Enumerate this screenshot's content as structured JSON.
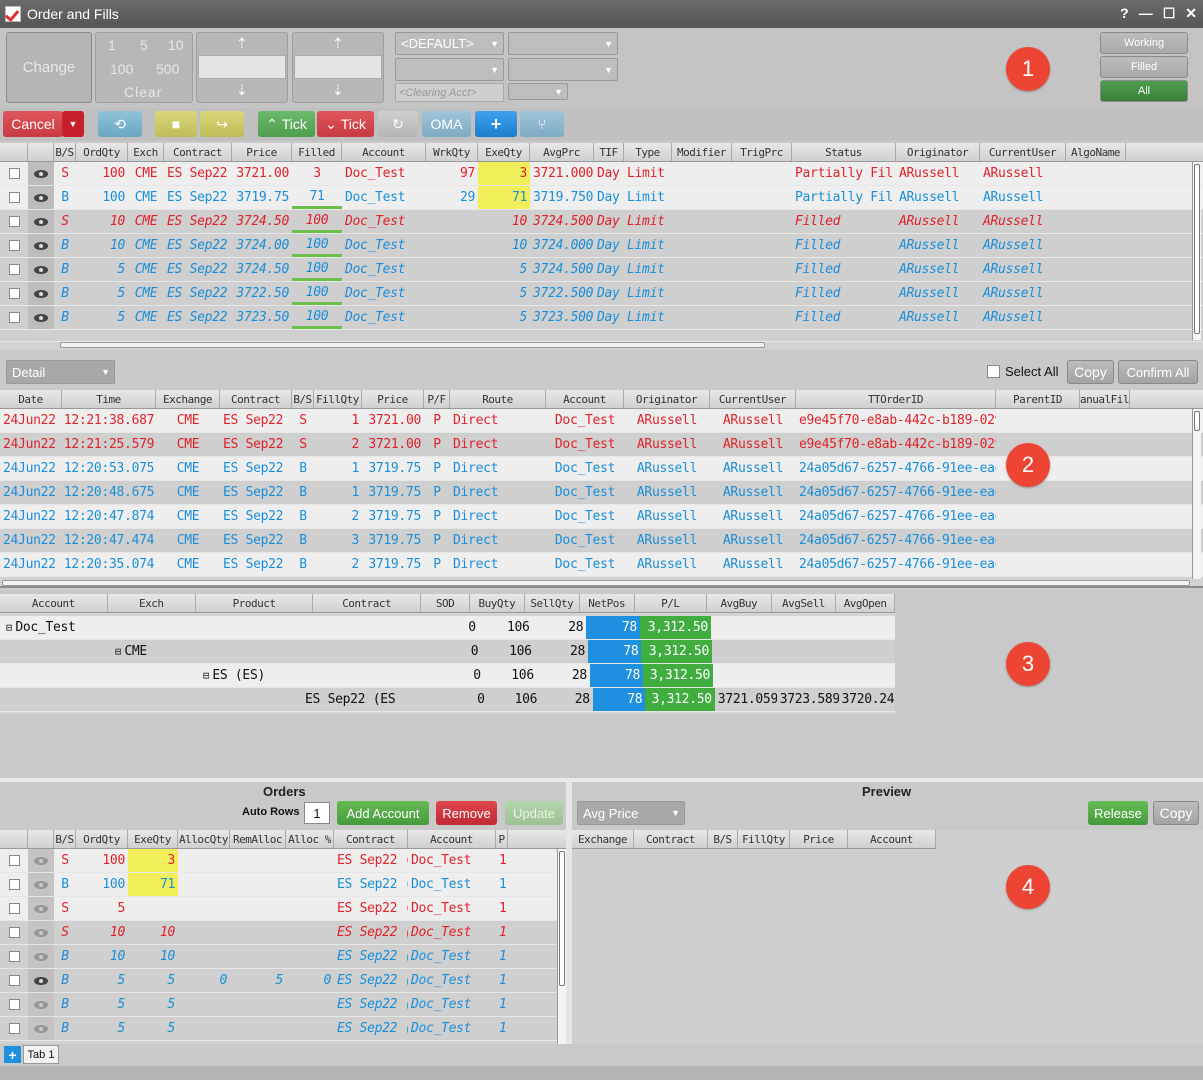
{
  "window": {
    "title": "Order and Fills",
    "controls": [
      "?",
      "—",
      "☐",
      "✕"
    ]
  },
  "toolbar": {
    "change": "Change",
    "qty": [
      "1",
      "5",
      "10",
      "100",
      "500",
      "Clear"
    ],
    "default_acct": "<DEFAULT>",
    "clearing_acct": "<Clearing Acct>",
    "status_buttons": [
      "Working",
      "Filled",
      "All"
    ]
  },
  "actions": {
    "cancel": "Cancel",
    "tick_up": "Tick",
    "tick_down": "Tick",
    "oma": "OMA",
    "plus": "+"
  },
  "orders": {
    "columns": [
      "",
      "",
      "B/S",
      "OrdQty",
      "Exch",
      "Contract",
      "Price",
      "Filled",
      "Account",
      "WrkQty",
      "ExeQty",
      "AvgPrc",
      "TIF",
      "Type",
      "Modifier",
      "TrigPrc",
      "Status",
      "Originator",
      "CurrentUser",
      "AlgoName"
    ],
    "rows": [
      {
        "bs": "S",
        "qty": "100",
        "exch": "CME",
        "contract": "ES Sep22 (",
        "price": "3721.00",
        "filled": "3",
        "account": "Doc_Test",
        "wrk": "97",
        "exe": "3",
        "avg": "3721.000",
        "tif": "Day",
        "type": "Limit",
        "status": "Partially Fil",
        "orig": "ARussell",
        "user": "ARussell"
      },
      {
        "bs": "B",
        "qty": "100",
        "exch": "CME",
        "contract": "ES Sep22 (",
        "price": "3719.75",
        "filled": "71",
        "account": "Doc_Test",
        "wrk": "29",
        "exe": "71",
        "avg": "3719.750",
        "tif": "Day",
        "type": "Limit",
        "status": "Partially Fil",
        "orig": "ARussell",
        "user": "ARussell"
      },
      {
        "bs": "S",
        "qty": "10",
        "exch": "CME",
        "contract": "ES Sep22 (",
        "price": "3724.50",
        "filled": "100",
        "account": "Doc_Test",
        "wrk": "",
        "exe": "10",
        "avg": "3724.500",
        "tif": "Day",
        "type": "Limit",
        "status": "Filled",
        "orig": "ARussell",
        "user": "ARussell"
      },
      {
        "bs": "B",
        "qty": "10",
        "exch": "CME",
        "contract": "ES Sep22 (",
        "price": "3724.00",
        "filled": "100",
        "account": "Doc_Test",
        "wrk": "",
        "exe": "10",
        "avg": "3724.000",
        "tif": "Day",
        "type": "Limit",
        "status": "Filled",
        "orig": "ARussell",
        "user": "ARussell"
      },
      {
        "bs": "B",
        "qty": "5",
        "exch": "CME",
        "contract": "ES Sep22 (",
        "price": "3724.50",
        "filled": "100",
        "account": "Doc_Test",
        "wrk": "",
        "exe": "5",
        "avg": "3724.500",
        "tif": "Day",
        "type": "Limit",
        "status": "Filled",
        "orig": "ARussell",
        "user": "ARussell"
      },
      {
        "bs": "B",
        "qty": "5",
        "exch": "CME",
        "contract": "ES Sep22 (",
        "price": "3722.50",
        "filled": "100",
        "account": "Doc_Test",
        "wrk": "",
        "exe": "5",
        "avg": "3722.500",
        "tif": "Day",
        "type": "Limit",
        "status": "Filled",
        "orig": "ARussell",
        "user": "ARussell"
      },
      {
        "bs": "B",
        "qty": "5",
        "exch": "CME",
        "contract": "ES Sep22 (",
        "price": "3723.50",
        "filled": "100",
        "account": "Doc_Test",
        "wrk": "",
        "exe": "5",
        "avg": "3723.500",
        "tif": "Day",
        "type": "Limit",
        "status": "Filled",
        "orig": "ARussell",
        "user": "ARussell"
      }
    ]
  },
  "fills": {
    "view": "Detail",
    "select_all": "Select All",
    "copy": "Copy",
    "confirm_all": "Confirm All",
    "columns": [
      "Date",
      "Time",
      "Exchange",
      "Contract",
      "B/S",
      "FillQty",
      "Price",
      "P/F",
      "Route",
      "Account",
      "Originator",
      "CurrentUser",
      "TTOrderID",
      "ParentID",
      "ManualFill"
    ],
    "rows": [
      {
        "date": "24Jun22",
        "time": "12:21:38.687",
        "exch": "CME",
        "contract": "ES Sep22 (",
        "bs": "S",
        "qty": "1",
        "price": "3721.00",
        "pf": "P",
        "route": "Direct",
        "account": "Doc_Test",
        "orig": "ARussell",
        "user": "ARussell",
        "id": "e9e45f70-e8ab-442c-b189-0297d4f"
      },
      {
        "date": "24Jun22",
        "time": "12:21:25.579",
        "exch": "CME",
        "contract": "ES Sep22 (",
        "bs": "S",
        "qty": "2",
        "price": "3721.00",
        "pf": "P",
        "route": "Direct",
        "account": "Doc_Test",
        "orig": "ARussell",
        "user": "ARussell",
        "id": "e9e45f70-e8ab-442c-b189-0297d4f"
      },
      {
        "date": "24Jun22",
        "time": "12:20:53.075",
        "exch": "CME",
        "contract": "ES Sep22 (",
        "bs": "B",
        "qty": "1",
        "price": "3719.75",
        "pf": "P",
        "route": "Direct",
        "account": "Doc_Test",
        "orig": "ARussell",
        "user": "ARussell",
        "id": "24a05d67-6257-4766-91ee-eadbad0"
      },
      {
        "date": "24Jun22",
        "time": "12:20:48.675",
        "exch": "CME",
        "contract": "ES Sep22 (",
        "bs": "B",
        "qty": "1",
        "price": "3719.75",
        "pf": "P",
        "route": "Direct",
        "account": "Doc_Test",
        "orig": "ARussell",
        "user": "ARussell",
        "id": "24a05d67-6257-4766-91ee-eadbad0"
      },
      {
        "date": "24Jun22",
        "time": "12:20:47.874",
        "exch": "CME",
        "contract": "ES Sep22 (",
        "bs": "B",
        "qty": "2",
        "price": "3719.75",
        "pf": "P",
        "route": "Direct",
        "account": "Doc_Test",
        "orig": "ARussell",
        "user": "ARussell",
        "id": "24a05d67-6257-4766-91ee-eadbad0"
      },
      {
        "date": "24Jun22",
        "time": "12:20:47.474",
        "exch": "CME",
        "contract": "ES Sep22 (",
        "bs": "B",
        "qty": "3",
        "price": "3719.75",
        "pf": "P",
        "route": "Direct",
        "account": "Doc_Test",
        "orig": "ARussell",
        "user": "ARussell",
        "id": "24a05d67-6257-4766-91ee-eadbad0"
      },
      {
        "date": "24Jun22",
        "time": "12:20:35.074",
        "exch": "CME",
        "contract": "ES Sep22 (",
        "bs": "B",
        "qty": "2",
        "price": "3719.75",
        "pf": "P",
        "route": "Direct",
        "account": "Doc_Test",
        "orig": "ARussell",
        "user": "ARussell",
        "id": "24a05d67-6257-4766-91ee-eadbad0"
      }
    ]
  },
  "positions": {
    "columns": [
      "Account",
      "Exch",
      "Product",
      "Contract",
      "SOD",
      "BuyQty",
      "SellQty",
      "NetPos",
      "P/L",
      "AvgBuy",
      "AvgSell",
      "AvgOpen"
    ],
    "rows": [
      {
        "label": "Doc_Test",
        "sod": "0",
        "buy": "106",
        "sell": "28",
        "net": "78",
        "pl": "3,312.50",
        "avgbuy": "",
        "avgsell": "",
        "avgopen": ""
      },
      {
        "label": "CME",
        "sod": "0",
        "buy": "106",
        "sell": "28",
        "net": "78",
        "pl": "3,312.50",
        "avgbuy": "",
        "avgsell": "",
        "avgopen": ""
      },
      {
        "label": "ES (ES)",
        "sod": "0",
        "buy": "106",
        "sell": "28",
        "net": "78",
        "pl": "3,312.50",
        "avgbuy": "",
        "avgsell": "",
        "avgopen": ""
      },
      {
        "label": "ES Sep22 (ES",
        "sod": "0",
        "buy": "106",
        "sell": "28",
        "net": "78",
        "pl": "3,312.50",
        "avgbuy": "3721.059",
        "avgsell": "3723.589",
        "avgopen": "3720.244"
      }
    ]
  },
  "alloc": {
    "title": "Orders",
    "auto_rows_label": "Auto Rows",
    "auto_rows": "1",
    "add_account": "Add Account",
    "remove": "Remove",
    "update": "Update",
    "columns": [
      "",
      "",
      "B/S",
      "OrdQty",
      "ExeQty",
      "AllocQty",
      "RemAlloc",
      "Alloc %",
      "Contract",
      "Account",
      "P"
    ],
    "rows": [
      {
        "bs": "S",
        "qty": "100",
        "exe": "3",
        "alloc": "",
        "rem": "",
        "pct": "",
        "contract": "ES Sep22 (",
        "account": "Doc_Test",
        "p": "1"
      },
      {
        "bs": "B",
        "qty": "100",
        "exe": "71",
        "alloc": "",
        "rem": "",
        "pct": "",
        "contract": "ES Sep22 (",
        "account": "Doc_Test",
        "p": "1"
      },
      {
        "bs": "S",
        "qty": "5",
        "exe": "",
        "alloc": "",
        "rem": "",
        "pct": "",
        "contract": "ES Sep22 (",
        "account": "Doc_Test",
        "p": "1"
      },
      {
        "bs": "S",
        "qty": "10",
        "exe": "10",
        "alloc": "",
        "rem": "",
        "pct": "",
        "contract": "ES Sep22 (",
        "account": "Doc_Test",
        "p": "1"
      },
      {
        "bs": "B",
        "qty": "10",
        "exe": "10",
        "alloc": "",
        "rem": "",
        "pct": "",
        "contract": "ES Sep22 (",
        "account": "Doc_Test",
        "p": "1"
      },
      {
        "bs": "B",
        "qty": "5",
        "exe": "5",
        "alloc": "0",
        "rem": "5",
        "pct": "0",
        "contract": "ES Sep22 (",
        "account": "Doc_Test",
        "p": "1"
      },
      {
        "bs": "B",
        "qty": "5",
        "exe": "5",
        "alloc": "",
        "rem": "",
        "pct": "",
        "contract": "ES Sep22 (",
        "account": "Doc_Test",
        "p": "1"
      },
      {
        "bs": "B",
        "qty": "5",
        "exe": "5",
        "alloc": "",
        "rem": "",
        "pct": "",
        "contract": "ES Sep22 (",
        "account": "Doc_Test",
        "p": "1"
      }
    ]
  },
  "preview": {
    "title": "Preview",
    "view": "Avg Price",
    "release": "Release",
    "copy": "Copy",
    "columns": [
      "Exchange",
      "Contract",
      "B/S",
      "FillQty",
      "Price",
      "Account"
    ]
  },
  "tabs": {
    "add": "+",
    "items": [
      "Tab 1"
    ]
  },
  "badges": [
    "1",
    "2",
    "3",
    "4"
  ]
}
